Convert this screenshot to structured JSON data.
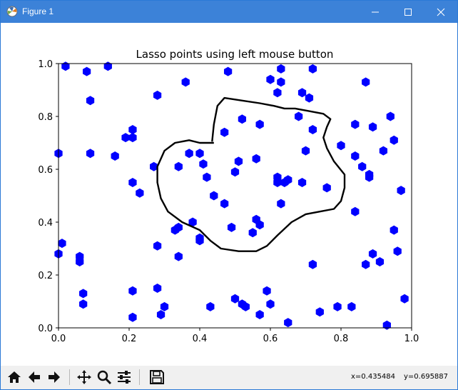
{
  "window": {
    "title": "Figure 1",
    "colors": {
      "titlebar": "#3c82d8",
      "marker": "#0000ff"
    }
  },
  "toolbar": {
    "buttons": [
      "home-icon",
      "back-arrow-icon",
      "forward-arrow-icon",
      "pan-icon",
      "zoom-icon",
      "subplots-icon",
      "save-icon"
    ],
    "coord_x": "x=0.435484",
    "coord_y": "y=0.695887"
  },
  "chart_data": {
    "type": "scatter",
    "title": "Lasso points using left mouse button",
    "xlabel": "",
    "ylabel": "",
    "xlim": [
      0,
      1
    ],
    "ylim": [
      0,
      1
    ],
    "xticks": [
      "0.0",
      "0.2",
      "0.4",
      "0.6",
      "0.8",
      "1.0"
    ],
    "yticks": [
      "0.0",
      "0.2",
      "0.4",
      "0.6",
      "0.8",
      "1.0"
    ],
    "grid": false,
    "marker": "hexagon",
    "color": "#0000ff",
    "points": [
      [
        0.02,
        0.99
      ],
      [
        0.08,
        0.97
      ],
      [
        0.14,
        0.99
      ],
      [
        0.36,
        0.93
      ],
      [
        0.28,
        0.88
      ],
      [
        0.48,
        0.97
      ],
      [
        0.09,
        0.86
      ],
      [
        0.62,
        0.89
      ],
      [
        0.63,
        0.98
      ],
      [
        0.6,
        0.94
      ],
      [
        0.63,
        0.93
      ],
      [
        0.72,
        0.98
      ],
      [
        0.87,
        0.93
      ],
      [
        0.69,
        0.89
      ],
      [
        0.71,
        0.87
      ],
      [
        0.52,
        0.79
      ],
      [
        0.57,
        0.77
      ],
      [
        0.47,
        0.74
      ],
      [
        0.68,
        0.8
      ],
      [
        0.72,
        0.75
      ],
      [
        0.84,
        0.77
      ],
      [
        0.89,
        0.76
      ],
      [
        0.94,
        0.8
      ],
      [
        0.95,
        0.71
      ],
      [
        0.21,
        0.75
      ],
      [
        0.21,
        0.72
      ],
      [
        0.19,
        0.72
      ],
      [
        0.16,
        0.65
      ],
      [
        0.09,
        0.66
      ],
      [
        0.0,
        0.66
      ],
      [
        0.8,
        0.69
      ],
      [
        0.7,
        0.67
      ],
      [
        0.84,
        0.65
      ],
      [
        0.92,
        0.67
      ],
      [
        0.37,
        0.66
      ],
      [
        0.4,
        0.66
      ],
      [
        0.41,
        0.62
      ],
      [
        0.51,
        0.63
      ],
      [
        0.56,
        0.64
      ],
      [
        0.34,
        0.61
      ],
      [
        0.27,
        0.61
      ],
      [
        0.42,
        0.57
      ],
      [
        0.5,
        0.59
      ],
      [
        0.86,
        0.61
      ],
      [
        0.88,
        0.58
      ],
      [
        0.88,
        0.57
      ],
      [
        0.62,
        0.57
      ],
      [
        0.62,
        0.55
      ],
      [
        0.64,
        0.55
      ],
      [
        0.65,
        0.56
      ],
      [
        0.69,
        0.55
      ],
      [
        0.76,
        0.53
      ],
      [
        0.97,
        0.52
      ],
      [
        0.21,
        0.55
      ],
      [
        0.23,
        0.51
      ],
      [
        0.44,
        0.5
      ],
      [
        0.47,
        0.47
      ],
      [
        0.63,
        0.47
      ],
      [
        0.84,
        0.44
      ],
      [
        0.38,
        0.4
      ],
      [
        0.56,
        0.41
      ],
      [
        0.57,
        0.39
      ],
      [
        0.34,
        0.38
      ],
      [
        0.33,
        0.37
      ],
      [
        0.49,
        0.38
      ],
      [
        0.55,
        0.36
      ],
      [
        0.95,
        0.37
      ],
      [
        0.4,
        0.34
      ],
      [
        0.4,
        0.33
      ],
      [
        0.01,
        0.32
      ],
      [
        0.0,
        0.28
      ],
      [
        0.28,
        0.31
      ],
      [
        0.06,
        0.27
      ],
      [
        0.06,
        0.25
      ],
      [
        0.34,
        0.27
      ],
      [
        0.89,
        0.28
      ],
      [
        0.96,
        0.29
      ],
      [
        0.91,
        0.25
      ],
      [
        0.87,
        0.24
      ],
      [
        0.72,
        0.24
      ],
      [
        0.07,
        0.13
      ],
      [
        0.07,
        0.09
      ],
      [
        0.21,
        0.14
      ],
      [
        0.28,
        0.15
      ],
      [
        0.59,
        0.14
      ],
      [
        0.5,
        0.11
      ],
      [
        0.52,
        0.09
      ],
      [
        0.53,
        0.08
      ],
      [
        0.43,
        0.08
      ],
      [
        0.3,
        0.08
      ],
      [
        0.6,
        0.09
      ],
      [
        0.74,
        0.06
      ],
      [
        0.79,
        0.08
      ],
      [
        0.83,
        0.08
      ],
      [
        0.98,
        0.11
      ],
      [
        0.57,
        0.05
      ],
      [
        0.21,
        0.04
      ],
      [
        0.29,
        0.05
      ],
      [
        0.65,
        0.02
      ],
      [
        0.93,
        0.01
      ]
    ],
    "lasso": [
      [
        0.435,
        0.705
      ],
      [
        0.44,
        0.77
      ],
      [
        0.45,
        0.84
      ],
      [
        0.47,
        0.87
      ],
      [
        0.52,
        0.86
      ],
      [
        0.57,
        0.85
      ],
      [
        0.61,
        0.84
      ],
      [
        0.64,
        0.83
      ],
      [
        0.67,
        0.83
      ],
      [
        0.71,
        0.82
      ],
      [
        0.75,
        0.81
      ],
      [
        0.77,
        0.79
      ],
      [
        0.76,
        0.76
      ],
      [
        0.75,
        0.72
      ],
      [
        0.76,
        0.68
      ],
      [
        0.78,
        0.63
      ],
      [
        0.81,
        0.58
      ],
      [
        0.81,
        0.53
      ],
      [
        0.8,
        0.48
      ],
      [
        0.78,
        0.45
      ],
      [
        0.74,
        0.44
      ],
      [
        0.7,
        0.43
      ],
      [
        0.66,
        0.4
      ],
      [
        0.62,
        0.35
      ],
      [
        0.59,
        0.31
      ],
      [
        0.56,
        0.29
      ],
      [
        0.51,
        0.29
      ],
      [
        0.46,
        0.3
      ],
      [
        0.43,
        0.33
      ],
      [
        0.4,
        0.37
      ],
      [
        0.35,
        0.4
      ],
      [
        0.31,
        0.44
      ],
      [
        0.29,
        0.49
      ],
      [
        0.28,
        0.55
      ],
      [
        0.28,
        0.61
      ],
      [
        0.3,
        0.67
      ],
      [
        0.33,
        0.7
      ],
      [
        0.37,
        0.71
      ],
      [
        0.4,
        0.7
      ],
      [
        0.42,
        0.7
      ],
      [
        0.44,
        0.7
      ]
    ]
  }
}
